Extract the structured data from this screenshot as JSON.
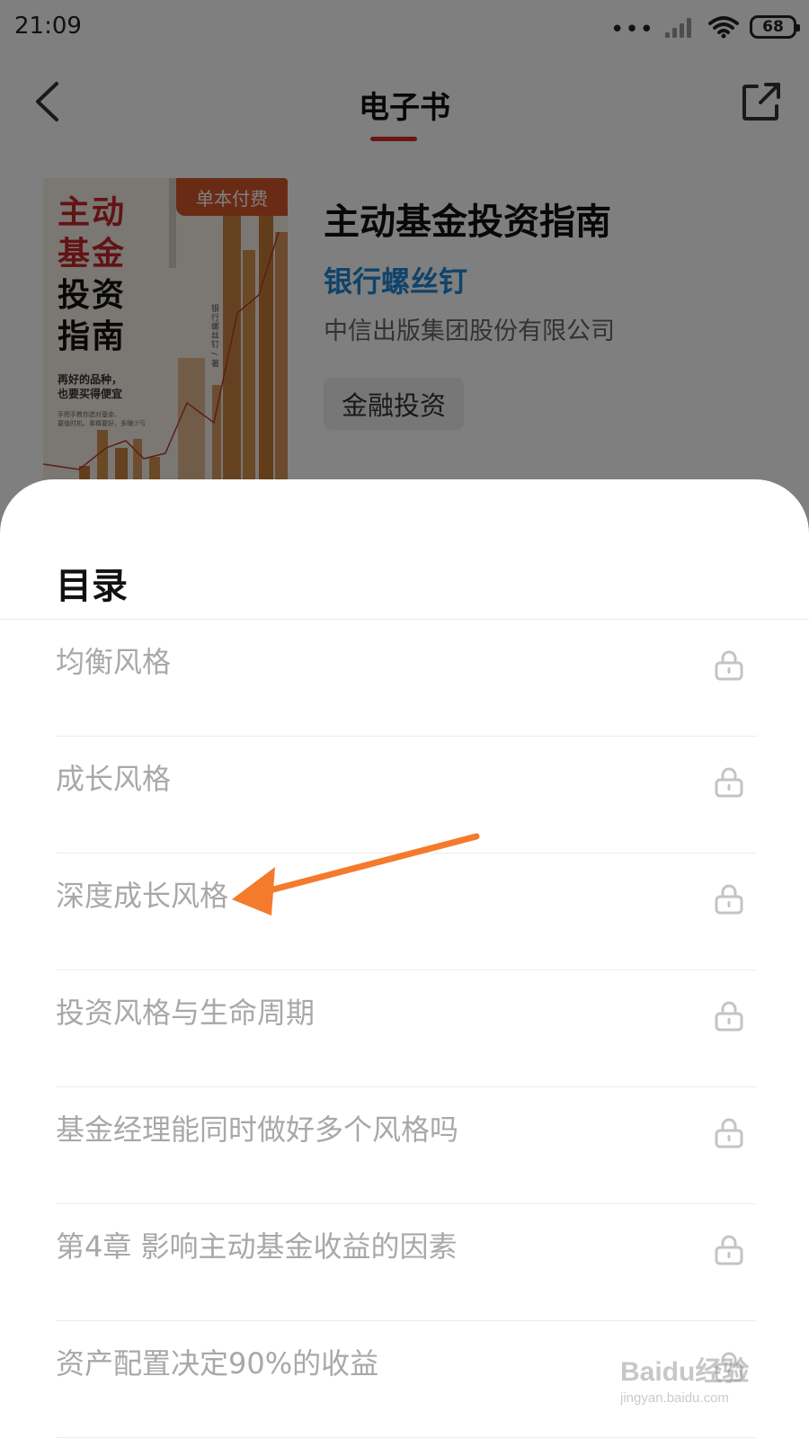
{
  "status_bar": {
    "time": "21:09",
    "dots": "•••",
    "battery": "68"
  },
  "nav": {
    "title": "电子书"
  },
  "book": {
    "cover": {
      "badge": "单本付费",
      "title_lines": [
        "主动",
        "基金",
        "投资",
        "指南"
      ],
      "subtitle_lines": [
        "再好的品种，",
        "也要买得便宜"
      ],
      "small_lines": [
        "手把手教你选对基金、",
        "要值时机、事精要好、多赚少亏"
      ],
      "vertical_text": "银行螺丝钉 / 著"
    },
    "title": "主动基金投资指南",
    "author": "银行螺丝钉",
    "publisher": "中信出版集团股份有限公司",
    "tag": "金融投资"
  },
  "toc": {
    "title": "目录",
    "items": [
      {
        "label": "均衡风格"
      },
      {
        "label": "成长风格"
      },
      {
        "label": "深度成长风格"
      },
      {
        "label": "投资风格与生命周期"
      },
      {
        "label": "基金经理能同时做好多个风格吗"
      },
      {
        "label": "第4章 影响主动基金收益的因素"
      },
      {
        "label": "资产配置决定90%的收益"
      }
    ]
  },
  "watermark": {
    "logo": "Baidu经验",
    "url": "jingyan.baidu.com"
  },
  "colors": {
    "accent_red": "#d62b2b",
    "author_blue": "#1e86d6",
    "badge_orange": "#d4572a",
    "annotation_arrow": "#f47a2c"
  },
  "icons": {
    "back": "chevron-left-icon",
    "share": "share-icon",
    "lock": "lock-icon"
  }
}
